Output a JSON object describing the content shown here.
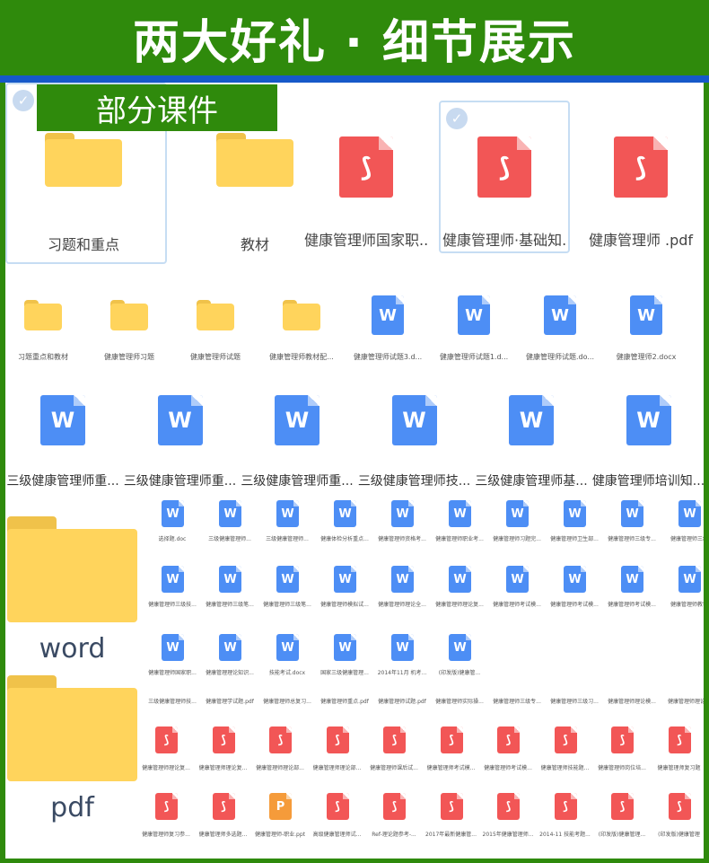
{
  "banner": {
    "title": "两大好礼 · 细节展示"
  },
  "badge": {
    "label": "部分课件"
  },
  "row1": [
    {
      "type": "folder",
      "label": "习题和重点",
      "selected": true
    },
    {
      "type": "folder",
      "label": "教材"
    },
    {
      "type": "pdf",
      "label": "健康管理师国家职..."
    },
    {
      "type": "pdf",
      "label": "健康管理师·基础知...",
      "selected": true
    },
    {
      "type": "pdf",
      "label": "健康管理师 .pdf"
    }
  ],
  "row2": [
    {
      "type": "folder",
      "label": "习题重点和教材"
    },
    {
      "type": "folder",
      "label": "健康管理师习题"
    },
    {
      "type": "folder",
      "label": "健康管理师试题"
    },
    {
      "type": "folder",
      "label": "健康管理师教材配..."
    },
    {
      "type": "word",
      "label": "健康管理师试题3.d..."
    },
    {
      "type": "word",
      "label": "健康管理师试题1.d..."
    },
    {
      "type": "word",
      "label": "健康管理师试题.do..."
    },
    {
      "type": "word",
      "label": "健康管理师2.docx"
    }
  ],
  "row3": [
    {
      "type": "word",
      "label": "三级健康管理师重..."
    },
    {
      "type": "word",
      "label": "三级健康管理师重..."
    },
    {
      "type": "word",
      "label": "三级健康管理师重..."
    },
    {
      "type": "word",
      "label": "三级健康管理师技..."
    },
    {
      "type": "word",
      "label": "三级健康管理师基..."
    },
    {
      "type": "word",
      "label": "健康管理师培训知..."
    }
  ],
  "categories": {
    "word": "word",
    "pdf": "pdf"
  },
  "icon_glyphs": {
    "word": "W",
    "pdf": "⟆",
    "ppt": "P"
  },
  "word_grid": [
    [
      "选择题.doc",
      "三级健康管理师...",
      "三级健康管理师...",
      "健康体检分析重点...",
      "健康管理师资格考...",
      "健康管理师职业考...",
      "健康管理师习题完...",
      "健康管理师卫生部...",
      "健康管理师三级专...",
      "健康管理师三级"
    ],
    [
      "健康管理师三级技...",
      "健康管理师三级笔...",
      "健康管理师三级笔...",
      "健康管理师模拟试...",
      "健康管理师理论全...",
      "健康管理师理论复...",
      "健康管理师考试模...",
      "健康管理师考试模...",
      "健康管理师考试模...",
      "健康管理师教学"
    ],
    [
      "健康管理师国家职...",
      "健康管理理论知识...",
      "技能考试.docx",
      "国家三级健康管理...",
      "2014年11月 机考...",
      "(印发版)健康管..."
    ]
  ],
  "pdf_top_labels": [
    "三级健康管理师技...",
    "健康管理学试题.pdf",
    "健康管理师总复习...",
    "健康管理师重点.pdf",
    "健康管理师试题.pdf",
    "健康管理师实际操...",
    "健康管理师三级专...",
    "健康管理师三级习...",
    "健康管理师理论模...",
    "健康管理师理论模"
  ],
  "pdf_grid": [
    [
      {
        "type": "pdf",
        "label": "健康管理师理论复..."
      },
      {
        "type": "pdf",
        "label": "健康管理师理论复..."
      },
      {
        "type": "pdf",
        "label": "健康管理师理论部..."
      },
      {
        "type": "pdf",
        "label": "健康管理师理论部..."
      },
      {
        "type": "pdf",
        "label": "健康管理师课后试..."
      },
      {
        "type": "pdf",
        "label": "健康管理师考试模..."
      },
      {
        "type": "pdf",
        "label": "健康管理师考试模..."
      },
      {
        "type": "pdf",
        "label": "健康管理师技能题..."
      },
      {
        "type": "pdf",
        "label": "健康管理师岗位培..."
      },
      {
        "type": "pdf",
        "label": "健康管理师复习题"
      }
    ],
    [
      {
        "type": "pdf",
        "label": "健康管理师复习参..."
      },
      {
        "type": "pdf",
        "label": "健康管理师多选题..."
      },
      {
        "type": "ppt",
        "label": "健康管理师-职业.ppt"
      },
      {
        "type": "pdf",
        "label": "高级健康管理师试..."
      },
      {
        "type": "pdf",
        "label": "Ref-理论题参考-..."
      },
      {
        "type": "pdf",
        "label": "2017年最新健康管..."
      },
      {
        "type": "pdf",
        "label": "2015年健康管理师..."
      },
      {
        "type": "pdf",
        "label": "2014-11 技能考题..."
      },
      {
        "type": "pdf",
        "label": "(印发版)健康管理..."
      },
      {
        "type": "pdf",
        "label": "(印发版)健康管理"
      }
    ]
  ]
}
